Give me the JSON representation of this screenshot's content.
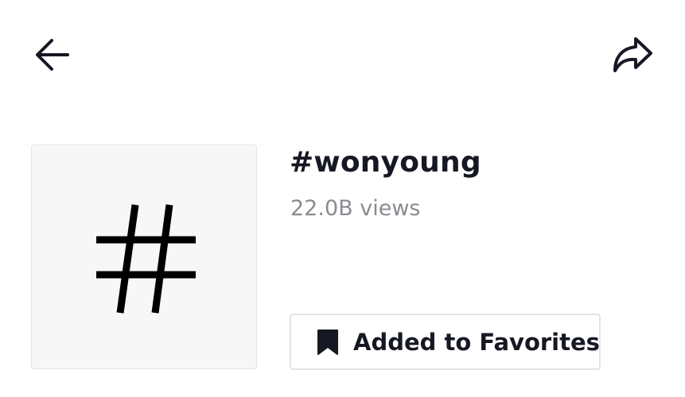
{
  "header": {
    "back_icon": "back-arrow-icon",
    "share_icon": "share-arrow-icon"
  },
  "hashtag": {
    "thumbnail_icon": "hashtag-icon",
    "title": "#wonyoung",
    "views": "22.0B views"
  },
  "actions": {
    "favorites_icon": "bookmark-icon",
    "favorites_label": "Added to Favorites"
  },
  "colors": {
    "text_primary": "#161823",
    "text_secondary": "#8a8b91",
    "thumb_bg": "#f7f7f7",
    "border": "#e3e3e4"
  }
}
